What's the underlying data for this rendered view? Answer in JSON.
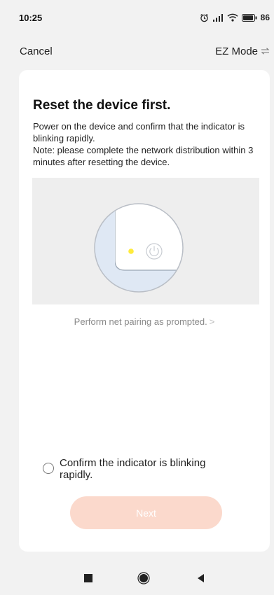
{
  "status_bar": {
    "time": "10:25",
    "battery": "86"
  },
  "nav": {
    "cancel_label": "Cancel",
    "mode_label": "EZ Mode",
    "mode_icon": "swap-arrows-icon"
  },
  "card": {
    "title": "Reset the device first.",
    "description_line1": "Power on the device and confirm that the indicator is blinking rapidly.",
    "description_line2": "Note: please complete the network distribution within 3 minutes after resetting the device.",
    "help_link": "Perform net pairing as prompted.",
    "confirm_label": "Confirm the indicator is blinking rapidly.",
    "confirm_checked": false,
    "next_label": "Next"
  },
  "colors": {
    "accent_disabled": "#fbd9cc",
    "indicator_led": "#ffeb3b"
  },
  "system_nav": {
    "items": [
      "recent-apps-icon",
      "home-icon",
      "back-icon"
    ]
  }
}
